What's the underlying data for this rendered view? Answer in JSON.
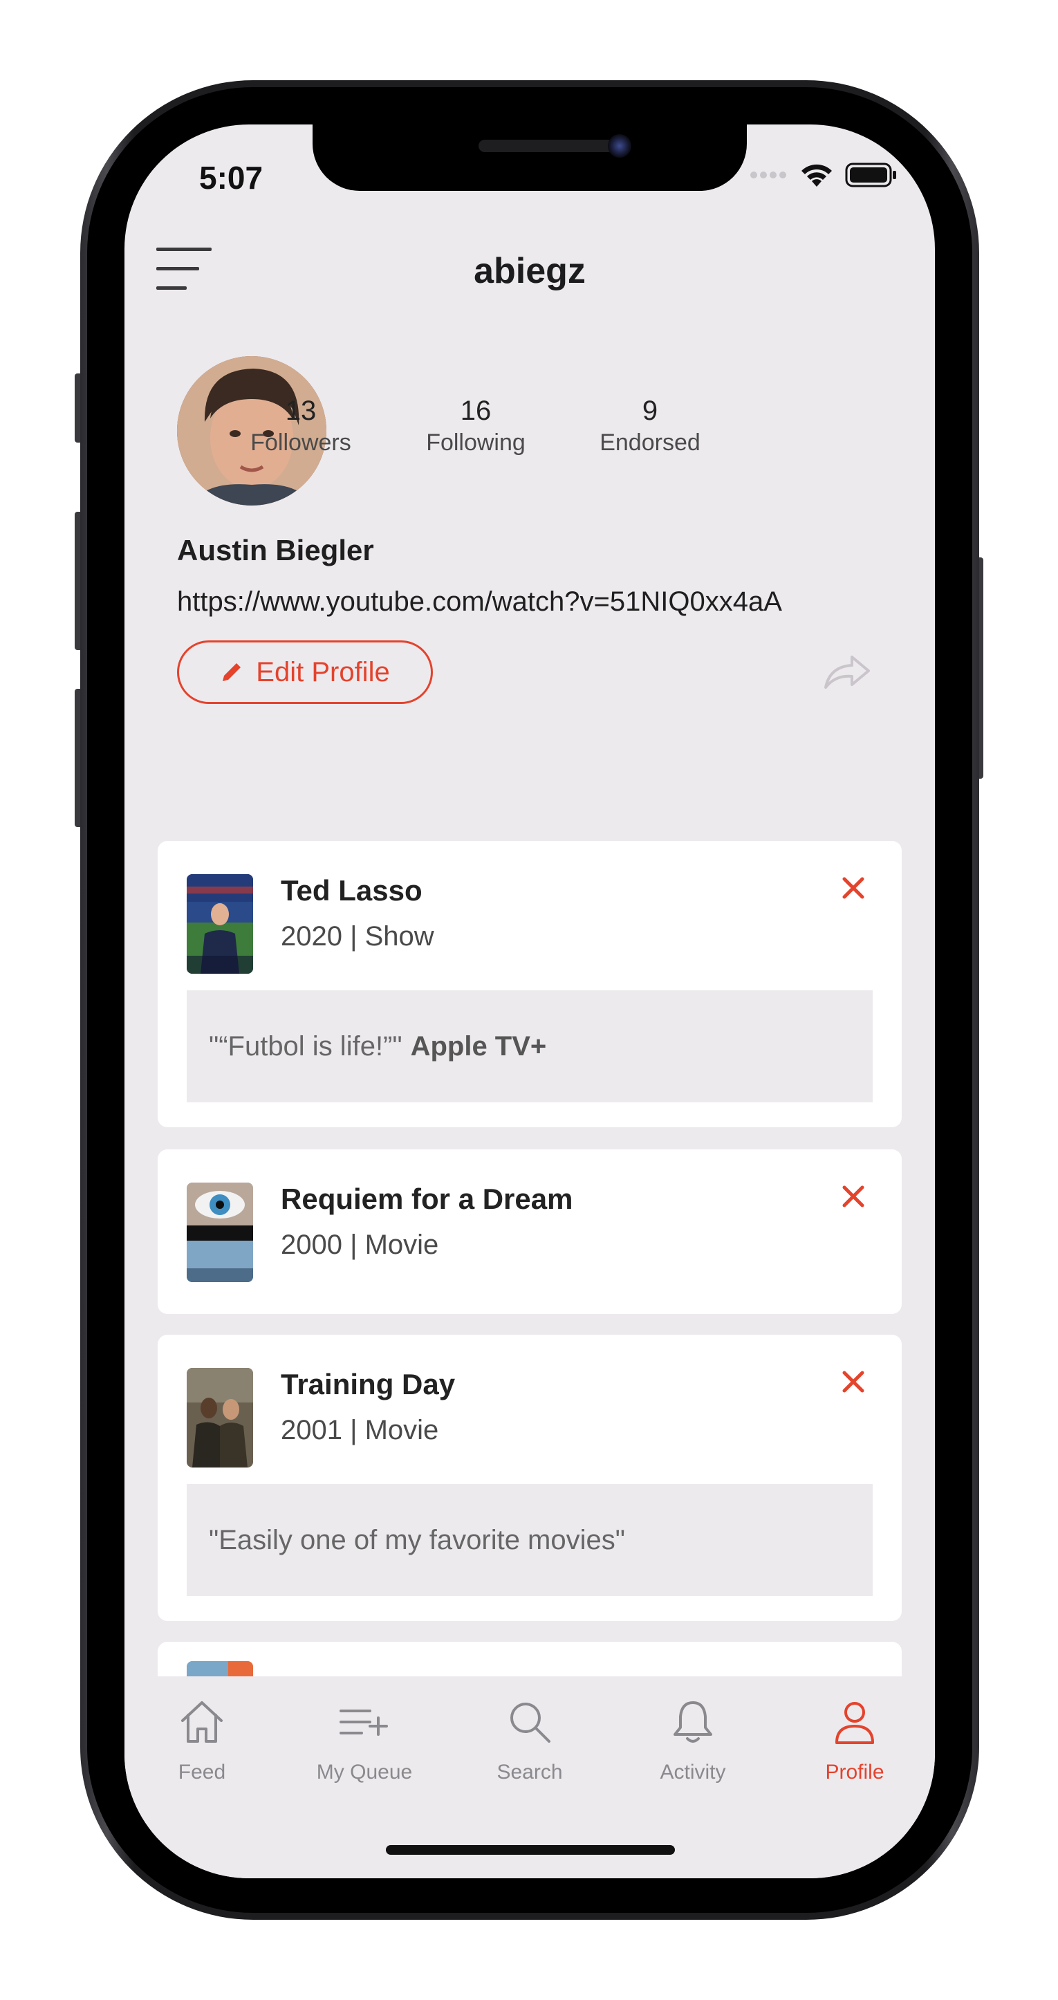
{
  "status_bar": {
    "time": "5:07"
  },
  "header": {
    "title": "abiegz"
  },
  "profile": {
    "stats": [
      {
        "count": "13",
        "label": "Followers"
      },
      {
        "count": "16",
        "label": "Following"
      },
      {
        "count": "9",
        "label": "Endorsed"
      }
    ],
    "name": "Austin Biegler",
    "link": "https://www.youtube.com/watch?v=51NIQ0xx4aA",
    "edit_label": "Edit Profile"
  },
  "items": [
    {
      "title": "Ted Lasso",
      "meta": "2020 | Show",
      "note": "\"“Futbol is life!”\"",
      "note_extra": "Apple TV+"
    },
    {
      "title": "Requiem for a Dream",
      "meta": "2000 | Movie"
    },
    {
      "title": "Training Day",
      "meta": "2001 | Movie",
      "note": "\"Easily one of my favorite movies\""
    }
  ],
  "tabs": [
    {
      "label": "Feed",
      "icon": "home-icon"
    },
    {
      "label": "My Queue",
      "icon": "queue-add-icon"
    },
    {
      "label": "Search",
      "icon": "search-icon"
    },
    {
      "label": "Activity",
      "icon": "bell-icon"
    },
    {
      "label": "Profile",
      "icon": "person-icon",
      "active": true
    }
  ],
  "colors": {
    "accent": "#e4432c",
    "background": "#edeaee",
    "card": "#ffffff"
  }
}
